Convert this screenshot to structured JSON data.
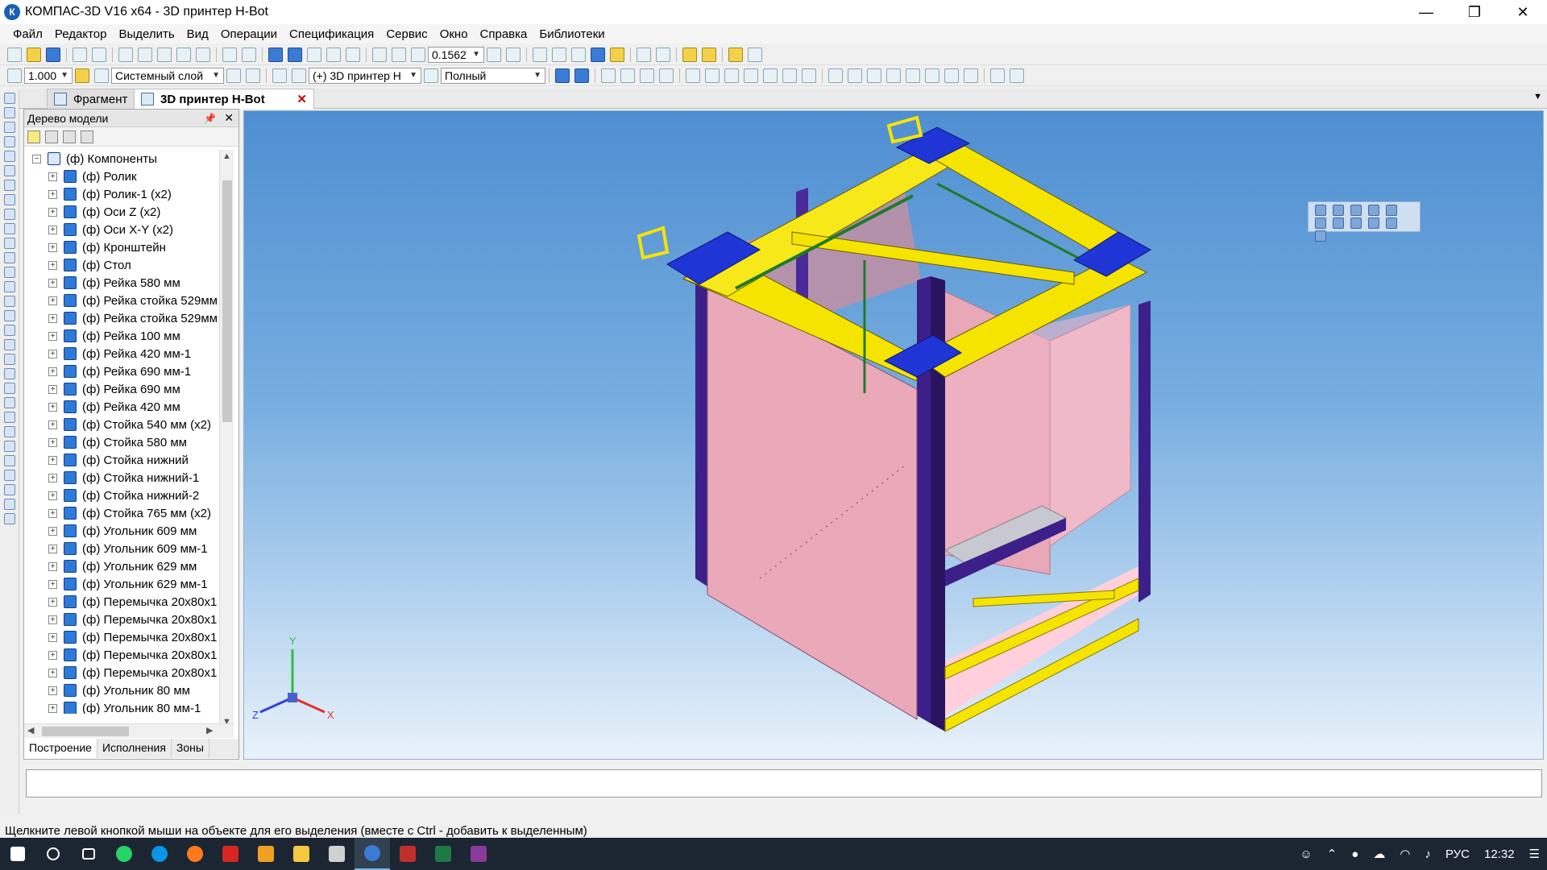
{
  "window": {
    "title": "КОМПАС-3D V16  x64 - 3D принтер H-Bot",
    "app_icon_letter": "К"
  },
  "menu": [
    "Файл",
    "Редактор",
    "Выделить",
    "Вид",
    "Операции",
    "Спецификация",
    "Сервис",
    "Окно",
    "Справка",
    "Библиотеки"
  ],
  "toolbar": {
    "zoom_value": "0.1562",
    "scale_value": "1.000",
    "layer_value": "Системный слой",
    "context_value": "(+) 3D принтер Н",
    "view_mode_value": "Полный"
  },
  "tabs": [
    {
      "label": "Фрагмент",
      "active": false
    },
    {
      "label": "3D принтер H-Bot",
      "active": true
    }
  ],
  "tree": {
    "title": "Дерево модели",
    "root": "(ф) Компоненты",
    "items": [
      "(ф) Ролик",
      "(ф) Ролик-1 (x2)",
      "(ф) Оси Z (x2)",
      "(ф) Оси X-Y (x2)",
      "(ф) Кронштейн",
      "(ф) Стол",
      "(ф) Рейка 580 мм",
      "(ф) Рейка стойка 529мм",
      "(ф) Рейка стойка 529мм",
      "(ф) Рейка 100 мм",
      "(ф) Рейка 420 мм-1",
      "(ф) Рейка 690 мм-1",
      "(ф) Рейка 690 мм",
      "(ф) Рейка 420 мм",
      "(ф) Стойка 540 мм (x2)",
      "(ф) Стойка 580 мм",
      "(ф) Стойка нижний",
      "(ф) Стойка нижний-1",
      "(ф) Стойка нижний-2",
      "(ф) Стойка 765 мм (x2)",
      "(ф) Угольник 609 мм",
      "(ф) Угольник 609 мм-1",
      "(ф) Угольник 629 мм",
      "(ф) Угольник 629 мм-1",
      "(ф) Перемычка 20x80x1",
      "(ф) Перемычка 20x80x1",
      "(ф) Перемычка 20x80x1",
      "(ф) Перемычка 20x80x1",
      "(ф) Перемычка 20x80x1",
      "(ф) Угольник 80 мм",
      "(ф) Угольник 80 мм-1"
    ]
  },
  "bottom_tabs": [
    "Построение",
    "Исполнения",
    "Зоны"
  ],
  "axes": {
    "x": "X",
    "y": "Y",
    "z": "Z"
  },
  "status_text": "Щелкните левой кнопкой мыши на объекте для его выделения (вместе с Ctrl - добавить к выделенным)",
  "tray": {
    "lang": "РУС",
    "time": "12:32"
  },
  "colors": {
    "frame_yellow": "#f5e400",
    "frame_purple": "#3d1f8a",
    "corner_blue": "#1f35d6",
    "panel_pink": "#e9a9b8"
  }
}
